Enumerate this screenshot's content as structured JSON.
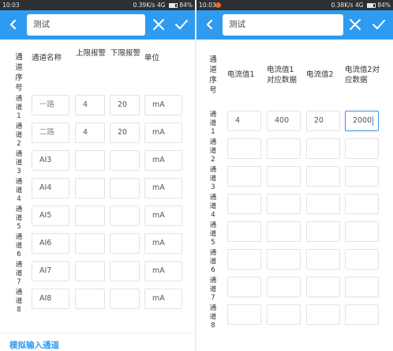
{
  "status_left": {
    "time": "10:03",
    "network": "0.39K/s",
    "signal": "4G",
    "battery": "84%"
  },
  "status_right": {
    "time": "10:03",
    "network": "0.38K/s",
    "signal": "4G",
    "battery": "84%"
  },
  "search": {
    "value": "测试"
  },
  "colors": {
    "accent": "#2f9bf0",
    "focus": "#3f8fe0",
    "notification": "#f26522"
  },
  "icons": {
    "back": "chevron-left-icon",
    "clear": "close-icon",
    "confirm": "check-icon"
  },
  "left_table": {
    "headers": {
      "index": "通道序号",
      "name": "通道名称",
      "upper": "上限报警",
      "lower": "下限报警",
      "unit": "单位"
    },
    "rows": [
      {
        "label": "通道1",
        "name": "一路",
        "upper": "4",
        "lower": "20",
        "unit": "mA"
      },
      {
        "label": "通道2",
        "name": "二路",
        "upper": "4",
        "lower": "20",
        "unit": "mA"
      },
      {
        "label": "通道3",
        "name": "AI3",
        "upper": "",
        "lower": "",
        "unit": "mA"
      },
      {
        "label": "通道4",
        "name": "AI4",
        "upper": "",
        "lower": "",
        "unit": "mA"
      },
      {
        "label": "通道5",
        "name": "AI5",
        "upper": "",
        "lower": "",
        "unit": "mA"
      },
      {
        "label": "通道6",
        "name": "AI6",
        "upper": "",
        "lower": "",
        "unit": "mA"
      },
      {
        "label": "通道7",
        "name": "AI7",
        "upper": "",
        "lower": "",
        "unit": "mA"
      },
      {
        "label": "通道8",
        "name": "AI8",
        "upper": "",
        "lower": "",
        "unit": "mA"
      }
    ]
  },
  "bottom_link": "模拟输入通道",
  "right_table": {
    "headers": {
      "index": "通道序号",
      "cur1": "电流值1",
      "data1": "电流值1对应数据",
      "cur2": "电流值2",
      "data2": "电流值2对应数据"
    },
    "rows": [
      {
        "label": "通道1",
        "cur1": "4",
        "data1": "400",
        "cur2": "20",
        "data2": "2000"
      },
      {
        "label": "通道2",
        "cur1": "",
        "data1": "",
        "cur2": "",
        "data2": ""
      },
      {
        "label": "通道3",
        "cur1": "",
        "data1": "",
        "cur2": "",
        "data2": ""
      },
      {
        "label": "通道4",
        "cur1": "",
        "data1": "",
        "cur2": "",
        "data2": ""
      },
      {
        "label": "通道5",
        "cur1": "",
        "data1": "",
        "cur2": "",
        "data2": ""
      },
      {
        "label": "通道6",
        "cur1": "",
        "data1": "",
        "cur2": "",
        "data2": ""
      },
      {
        "label": "通道7",
        "cur1": "",
        "data1": "",
        "cur2": "",
        "data2": ""
      },
      {
        "label": "通道8",
        "cur1": "",
        "data1": "",
        "cur2": "",
        "data2": ""
      }
    ]
  }
}
